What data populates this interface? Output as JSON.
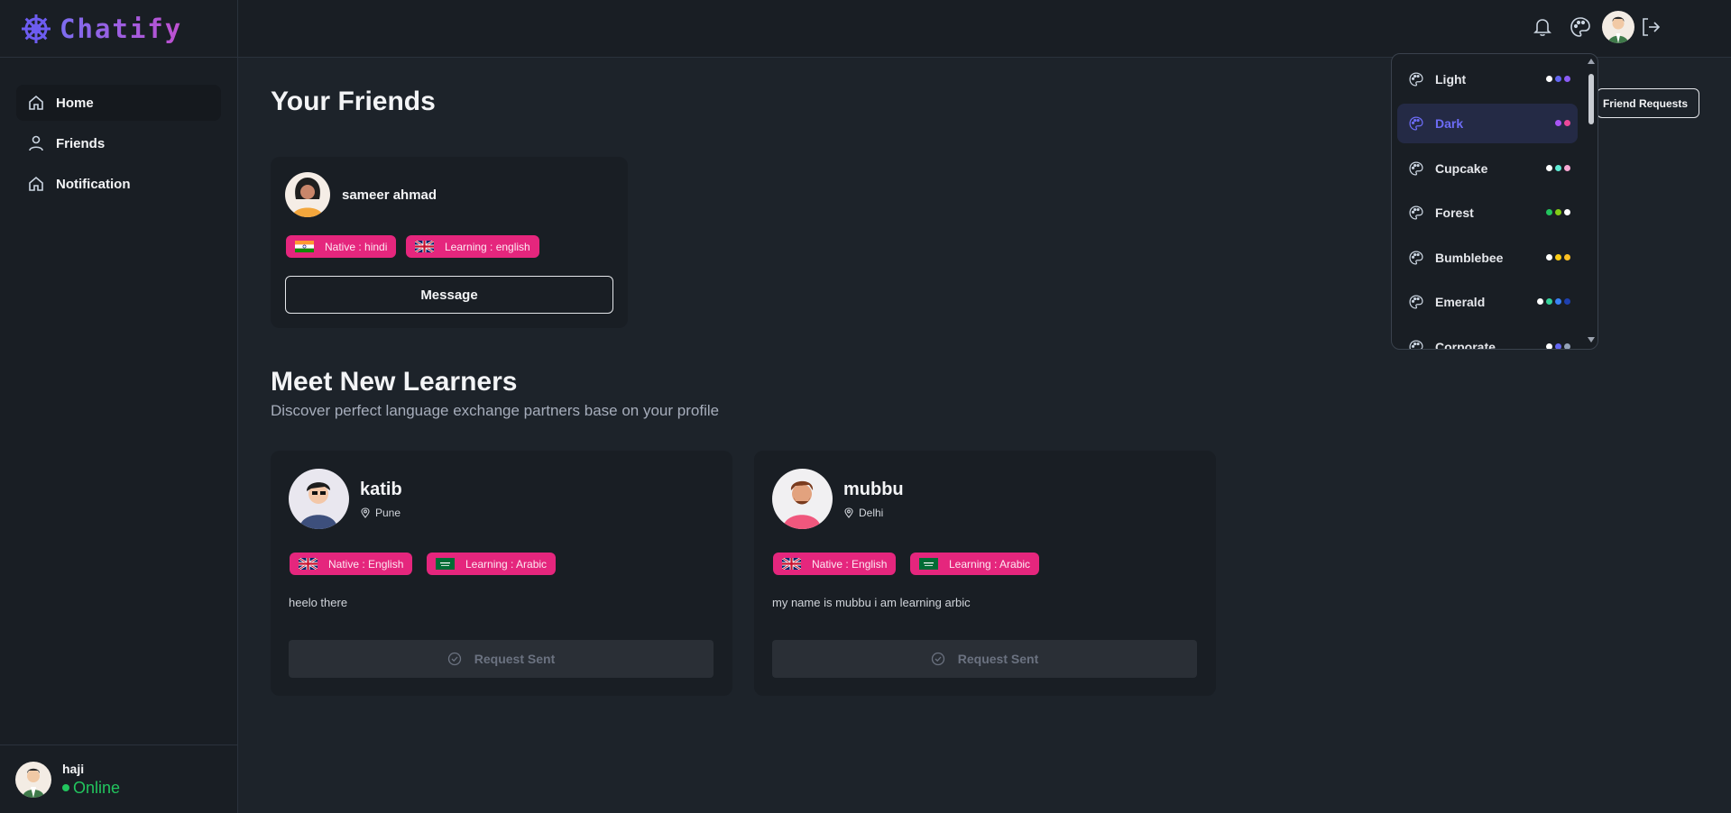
{
  "app": {
    "name": "Chatify"
  },
  "sidebar": {
    "items": [
      {
        "label": "Home",
        "icon": "home-icon",
        "active": true
      },
      {
        "label": "Friends",
        "icon": "user-icon",
        "active": false
      },
      {
        "label": "Notification",
        "icon": "home-icon",
        "active": false
      }
    ]
  },
  "profile": {
    "name": "haji",
    "status": "Online",
    "status_color": "#22c55e"
  },
  "header": {
    "icons": [
      "bell-icon",
      "palette-icon",
      "avatar",
      "logout-icon"
    ]
  },
  "friends_section": {
    "title": "Your Friends",
    "friend_requests_label": "Friend Requests",
    "friends": [
      {
        "name": "sameer ahmad",
        "native": "Native : hindi",
        "learning": "Learning : english",
        "message_label": "Message"
      }
    ]
  },
  "learners_section": {
    "title": "Meet New Learners",
    "subtitle": "Discover perfect language exchange partners base on your profile",
    "learners": [
      {
        "name": "katib",
        "location": "Pune",
        "native": "Native : English",
        "learning": "Learning : Arabic",
        "bio": "heelo there",
        "button_label": "Request Sent"
      },
      {
        "name": "mubbu",
        "location": "Delhi",
        "native": "Native : English",
        "learning": "Learning : Arabic",
        "bio": "my name is mubbu i am learning arbic",
        "button_label": "Request Sent"
      }
    ]
  },
  "theme_dropdown": {
    "themes": [
      {
        "label": "Light",
        "swatches": [
          "#ffffff",
          "#6366f1",
          "#8b5cf6"
        ],
        "active": false
      },
      {
        "label": "Dark",
        "swatches": [
          "#a855f7",
          "#ec4899"
        ],
        "active": true
      },
      {
        "label": "Cupcake",
        "swatches": [
          "#ffffff",
          "#5eead4",
          "#f9a8d4"
        ],
        "active": false
      },
      {
        "label": "Forest",
        "swatches": [
          "#22c55e",
          "#84cc16",
          "#ffffff"
        ],
        "active": false
      },
      {
        "label": "Bumblebee",
        "swatches": [
          "#ffffff",
          "#facc15",
          "#fbbf24"
        ],
        "active": false
      },
      {
        "label": "Emerald",
        "swatches": [
          "#ffffff",
          "#34d399",
          "#3b82f6",
          "#1e40af"
        ],
        "active": false
      },
      {
        "label": "Corporate",
        "swatches": [
          "#ffffff",
          "#6366f1",
          "#94a3b8"
        ],
        "active": false
      }
    ]
  },
  "colors": {
    "accent": "#e5267d",
    "brand": "#6d6cf7",
    "bg": "#1d232a"
  }
}
